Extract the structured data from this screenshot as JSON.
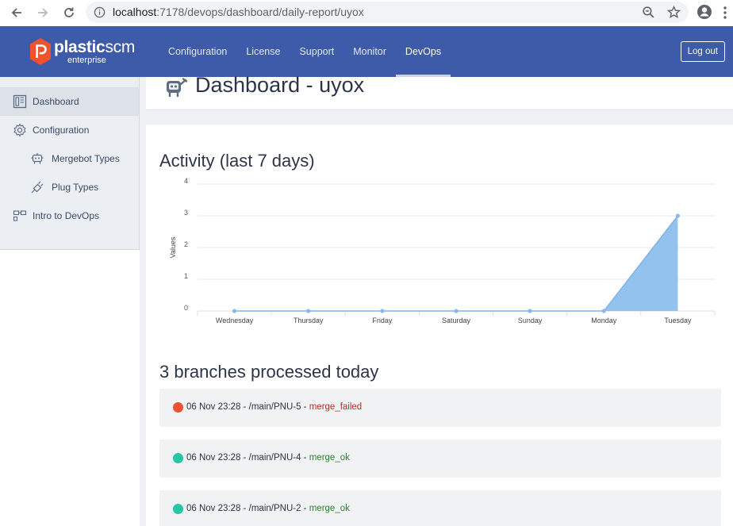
{
  "browser": {
    "url_host": "localhost",
    "url_path": ":7178/devops/dashboard/daily-report/uyox"
  },
  "header": {
    "logo_main": "plastic",
    "logo_scm": "scm",
    "logo_sub": "enterprise",
    "nav": [
      {
        "label": "Configuration",
        "active": false
      },
      {
        "label": "License",
        "active": false
      },
      {
        "label": "Support",
        "active": false
      },
      {
        "label": "Monitor",
        "active": false
      },
      {
        "label": "DevOps",
        "active": true
      }
    ],
    "logout_label": "Log out"
  },
  "sidebar": {
    "items": [
      {
        "label": "Dashboard",
        "icon": "dashboard-icon",
        "active": true
      },
      {
        "label": "Configuration",
        "icon": "gear-icon",
        "active": false
      },
      {
        "label": "Mergebot Types",
        "icon": "robot-icon",
        "active": false
      },
      {
        "label": "Plug Types",
        "icon": "plug-icon",
        "active": false
      },
      {
        "label": "Intro to DevOps",
        "icon": "blocks-icon",
        "active": false
      }
    ]
  },
  "page": {
    "title": "Dashboard - uyox",
    "activity_title": "Activity (last 7 days)",
    "branches_title": "3 branches processed today"
  },
  "chart_data": {
    "type": "area",
    "categories": [
      "Wednesday",
      "Thursday",
      "Friday",
      "Saturday",
      "Sunday",
      "Monday",
      "Tuesday"
    ],
    "values": [
      0,
      0,
      0,
      0,
      0,
      0,
      3
    ],
    "title": "",
    "xlabel": "",
    "ylabel": "Values",
    "ylim": [
      0,
      4
    ],
    "yticks": [
      "0",
      "1",
      "2",
      "3",
      "4"
    ],
    "grid": true,
    "colors": {
      "fill": "#94c2ef",
      "line": "#7fb3e8",
      "point": "#8ab8ea"
    }
  },
  "branches": [
    {
      "datetime": "06 Nov 23:28",
      "branch": "/main/PNU-5",
      "status": "merge_failed",
      "dot_color": "#ee5033"
    },
    {
      "datetime": "06 Nov 23:28",
      "branch": "/main/PNU-4",
      "status": "merge_ok",
      "dot_color": "#26c6a6"
    },
    {
      "datetime": "06 Nov 23:28",
      "branch": "/main/PNU-2",
      "status": "merge_ok",
      "dot_color": "#26c6a6"
    }
  ]
}
